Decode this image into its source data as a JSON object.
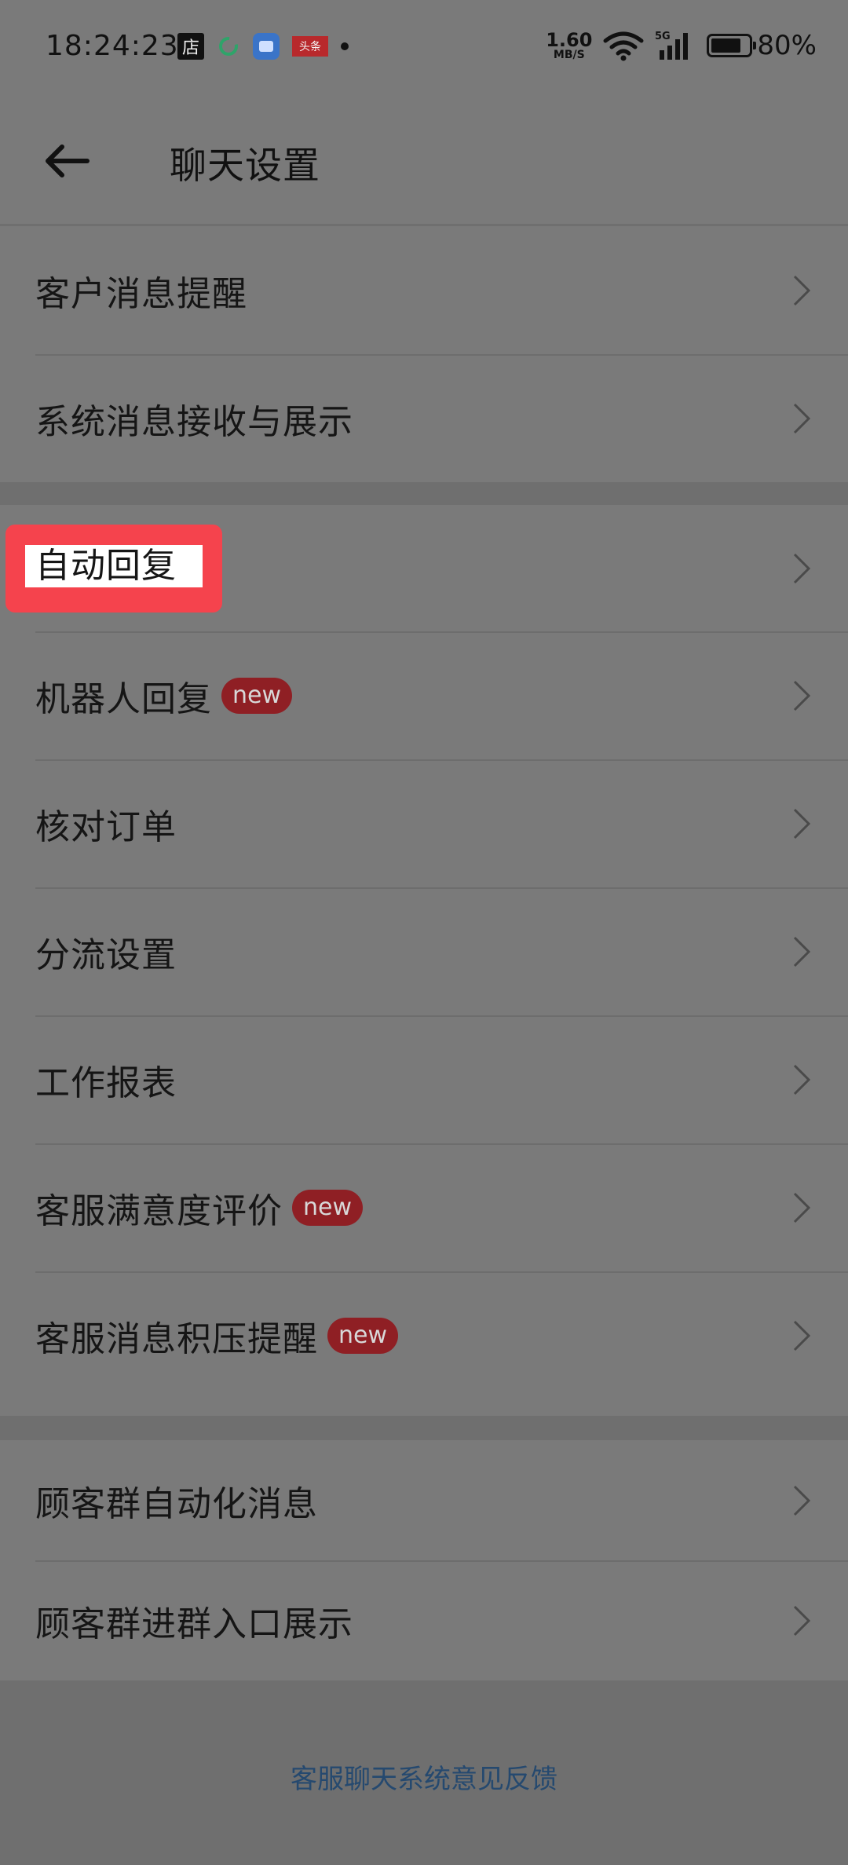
{
  "status_bar": {
    "time": "18:24:23",
    "store_icon_text": "店",
    "app_icon_text": "头条",
    "net_speed_value": "1.60",
    "net_speed_unit": "MB/S",
    "signal_label": "5G",
    "battery_text": "80%",
    "battery_level": 0.8
  },
  "header": {
    "title": "聊天设置"
  },
  "groups": {
    "g1": {
      "items": [
        {
          "label": "客户消息提醒"
        },
        {
          "label": "系统消息接收与展示"
        }
      ]
    },
    "g2": {
      "items": [
        {
          "label": "自动回复"
        },
        {
          "label": "机器人回复",
          "badge": "new"
        },
        {
          "label": "核对订单"
        },
        {
          "label": "分流设置"
        },
        {
          "label": "工作报表"
        },
        {
          "label": "客服满意度评价",
          "badge": "new"
        },
        {
          "label": "客服消息积压提醒",
          "badge": "new"
        }
      ]
    },
    "g3": {
      "items": [
        {
          "label": "顾客群自动化消息"
        },
        {
          "label": "顾客群进群入口展示"
        }
      ]
    }
  },
  "footer": {
    "feedback_link": "客服聊天系统意见反馈"
  },
  "colors": {
    "overlay_bg": "#6f6f6f",
    "panel_bg": "#7a7a7a",
    "highlight": "#f5434d",
    "badge_bg": "#8f1f24",
    "link": "#25496f"
  }
}
